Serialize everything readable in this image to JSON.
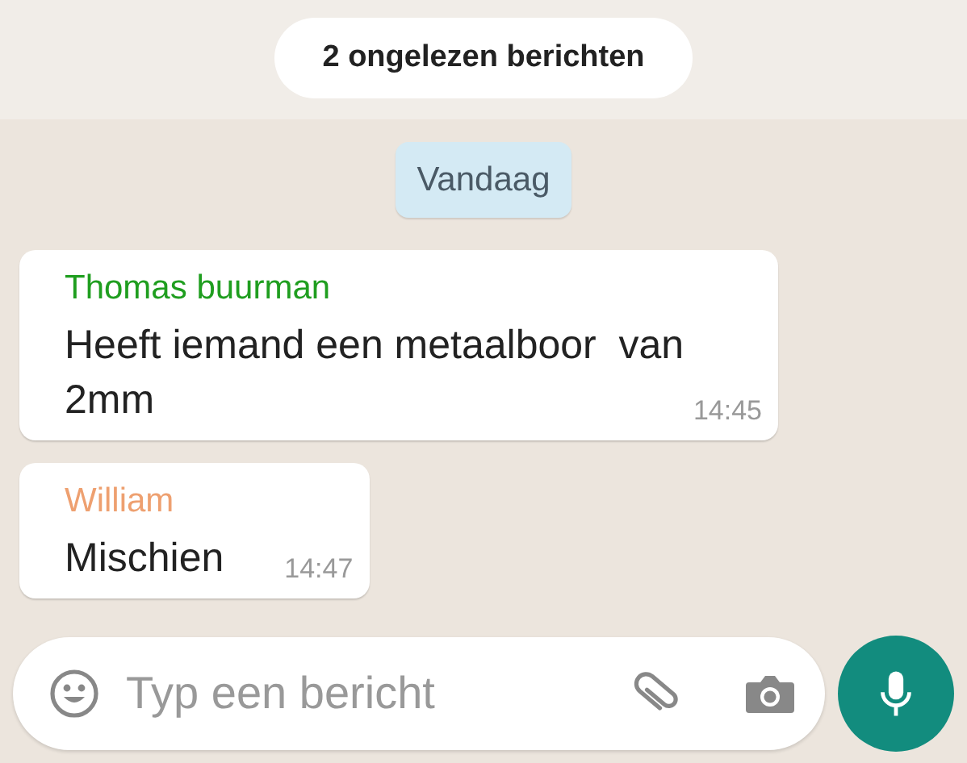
{
  "unread_banner": {
    "text": "2 ongelezen berichten"
  },
  "date_chip": {
    "text": "Vandaag"
  },
  "messages": [
    {
      "sender": "Thomas buurman",
      "color": "#1f9e1f",
      "text": "Heeft iemand een metaalboor  van 2mm",
      "time": "14:45"
    },
    {
      "sender": "William",
      "color": "#eea070",
      "text": "Mischien",
      "time": "14:47"
    }
  ],
  "composer": {
    "placeholder": "Typ een bericht"
  }
}
